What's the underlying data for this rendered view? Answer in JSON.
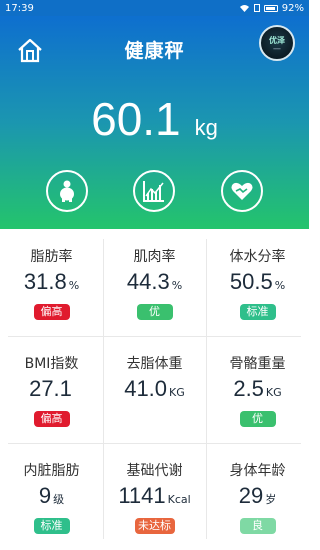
{
  "status_bar": {
    "time": "17:39",
    "battery": "92%"
  },
  "header": {
    "title": "健康秤",
    "avatar_text": "优泽"
  },
  "weight": {
    "value": "60.1",
    "unit": "kg"
  },
  "actions": [
    {
      "name": "body-shape",
      "icon": "body-figure-icon"
    },
    {
      "name": "trend-chart",
      "icon": "chart-icon"
    },
    {
      "name": "health-heart",
      "icon": "heart-hands-icon"
    }
  ],
  "metrics": [
    {
      "label": "脂肪率",
      "value": "31.8",
      "unit": "%",
      "status": "偏高",
      "status_color": "#e01b2e"
    },
    {
      "label": "肌肉率",
      "value": "44.3",
      "unit": "%",
      "status": "优",
      "status_color": "#3ac06e"
    },
    {
      "label": "体水分率",
      "value": "50.5",
      "unit": "%",
      "status": "标准",
      "status_color": "#2fbf8b"
    },
    {
      "label": "BMI指数",
      "value": "27.1",
      "unit": "",
      "status": "偏高",
      "status_color": "#e01b2e"
    },
    {
      "label": "去脂体重",
      "value": "41.0",
      "unit": "KG",
      "status": "",
      "status_color": ""
    },
    {
      "label": "骨骼重量",
      "value": "2.5",
      "unit": "KG",
      "status": "优",
      "status_color": "#3ac06e"
    },
    {
      "label": "内脏脂肪",
      "value": "9",
      "unit": "级",
      "status": "标准",
      "status_color": "#2fbf8b"
    },
    {
      "label": "基础代谢",
      "value": "1141",
      "unit": "Kcal",
      "status": "未达标",
      "status_color": "#e8663e"
    },
    {
      "label": "身体年龄",
      "value": "29",
      "unit": "岁",
      "status": "良",
      "status_color": "#7fd9a4"
    }
  ]
}
